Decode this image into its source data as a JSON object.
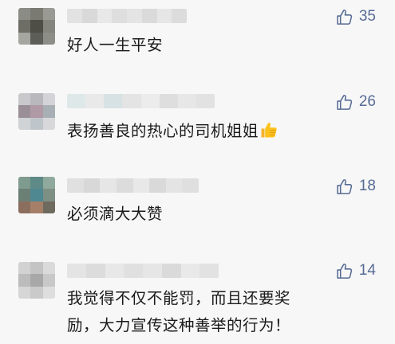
{
  "comments": [
    {
      "text": "好人一生平安",
      "likes": "35",
      "avatar_colors": [
        "#8c8c86",
        "#7a7a72",
        "#9a9a94",
        "#6e6e66",
        "#4e4e46",
        "#858580",
        "#a6a6a0",
        "#5e5e58",
        "#8e8e88"
      ],
      "name_colors": [
        "#e2e2e2",
        "#d9d9d9",
        "#e8e8e8",
        "#dedede",
        "#e4e4e4",
        "#dadada",
        "#e6e6e6",
        "#dcdcdc"
      ]
    },
    {
      "text": "表扬善良的热心的司机姐姐",
      "likes": "26",
      "avatar_colors": [
        "#c9c9cc",
        "#b8b8bd",
        "#d4d4d8",
        "#9a8f96",
        "#b09aa5",
        "#a8b0b6",
        "#cfd3d6",
        "#bfc6cb",
        "#d8d8da"
      ],
      "name_colors": [
        "#dfe8e8",
        "#e9e9e9",
        "#d6e2e4",
        "#e4e4e4",
        "#ececec",
        "#dedede",
        "#e7e7e7",
        "#e2e2e2"
      ]
    },
    {
      "text": "必须滴大大赞",
      "likes": "18",
      "avatar_colors": [
        "#7f9a8e",
        "#5d8a86",
        "#8faa9c",
        "#6c7f74",
        "#4f8890",
        "#7e8f84",
        "#8c6e5e",
        "#a57f68",
        "#6f6a5e"
      ],
      "name_colors": [
        "#e0e0e0",
        "#d8d8d8",
        "#e6e6e6",
        "#dcdcdc",
        "#e8e8e8",
        "#d9d9d9",
        "#e4e4e4",
        "#dfdfdf"
      ]
    },
    {
      "text_lines": [
        "我觉得不仅不能罚，而且还要奖",
        "励，大力宣传这种善举的行为！"
      ],
      "likes": "14",
      "avatar_colors": [
        "#d2d2d2",
        "#c4c4c4",
        "#dadada",
        "#bcbcbc",
        "#a8a8a8",
        "#c8c8c8",
        "#d6d6d6",
        "#cacaca",
        "#dedede"
      ],
      "name_colors": [
        "#e4e4e4",
        "#dcdcdc",
        "#e8e8e8",
        "#e0e0e0",
        "#e6e6e6",
        "#dadada",
        "#e9e9e9",
        "#e2e2e2"
      ]
    }
  ],
  "icons": {
    "like": "thumbs-up-outline-icon",
    "emoji": "thumbs-up-emoji-icon"
  },
  "colors": {
    "like_blue": "#576b95",
    "background": "#f7f7f7",
    "text": "#1a1a1a"
  }
}
